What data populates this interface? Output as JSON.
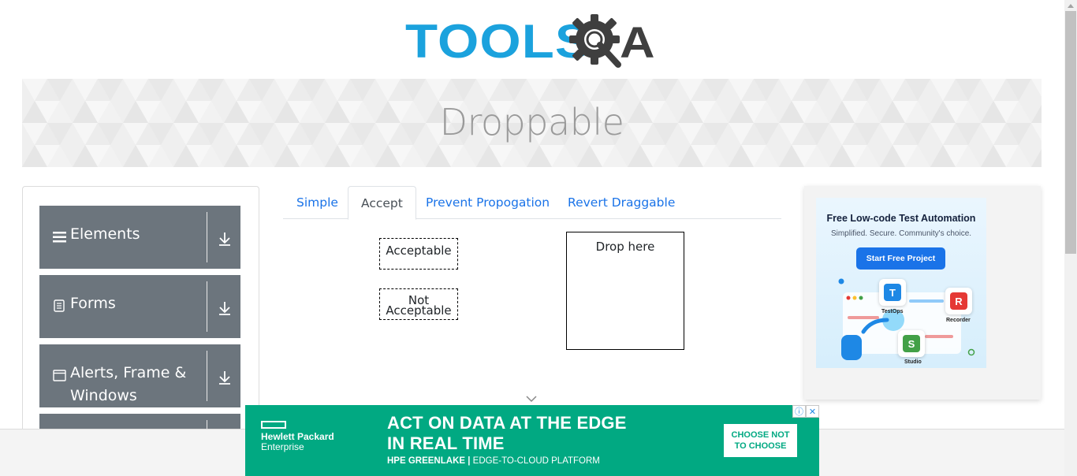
{
  "logo": {
    "text": "TOOLS",
    "suffix": "A"
  },
  "banner": {
    "title": "Droppable"
  },
  "sidebar": {
    "groups": [
      {
        "label": "Elements",
        "icon": "hamburger-icon"
      },
      {
        "label": "Forms",
        "icon": "document-icon"
      },
      {
        "label": "Alerts, Frame &",
        "label2": "Windows",
        "icon": "window-icon"
      },
      {
        "label": "",
        "icon": ""
      }
    ]
  },
  "tabs": [
    {
      "label": "Simple",
      "active": false
    },
    {
      "label": "Accept",
      "active": true
    },
    {
      "label": "Prevent Propogation",
      "active": false
    },
    {
      "label": "Revert Draggable",
      "active": false
    }
  ],
  "draggables": {
    "acceptable": "Acceptable",
    "not_acceptable_1": "Not",
    "not_acceptable_2": "Acceptable"
  },
  "droppable": {
    "label": "Drop here"
  },
  "side_ad": {
    "headline": "Free Low-code Test Automation",
    "sub": "Simplified. Secure. Community's choice.",
    "cta": "Start Free Project",
    "products": [
      "TestOps",
      "Recorder",
      "Studio"
    ]
  },
  "bottom_ad": {
    "brand_line1": "Hewlett Packard",
    "brand_line2": "Enterprise",
    "headline1": "ACT ON DATA AT THE EDGE",
    "headline2": "IN REAL TIME",
    "tag_bold": "HPE GREENLAKE |",
    "tag_rest": " EDGE-TO-CLOUD PLATFORM",
    "cta_line1": "CHOOSE NOT",
    "cta_line2": "TO CHOOSE",
    "adchoice_info": "ⓘ",
    "adchoice_close": "✕"
  },
  "colors": {
    "logo_blue": "#1ba2dd",
    "logo_dark": "#3f3f3f",
    "sidebar_group": "#6c757d",
    "tab_link": "#1a73e8",
    "ad_green": "#01a982"
  }
}
